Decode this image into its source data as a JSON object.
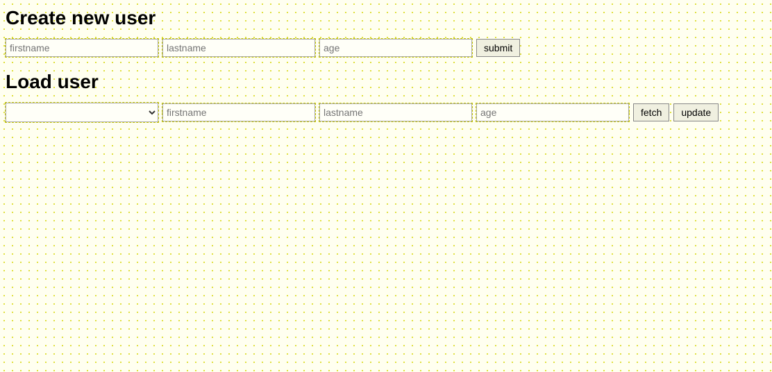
{
  "create_section": {
    "title": "Create new user",
    "firstname_placeholder": "firstname",
    "lastname_placeholder": "lastname",
    "age_placeholder": "age",
    "submit_label": "submit"
  },
  "load_section": {
    "title": "Load user",
    "firstname_placeholder": "firstname",
    "lastname_placeholder": "lastname",
    "age_placeholder": "age",
    "fetch_label": "fetch",
    "update_label": "update"
  }
}
